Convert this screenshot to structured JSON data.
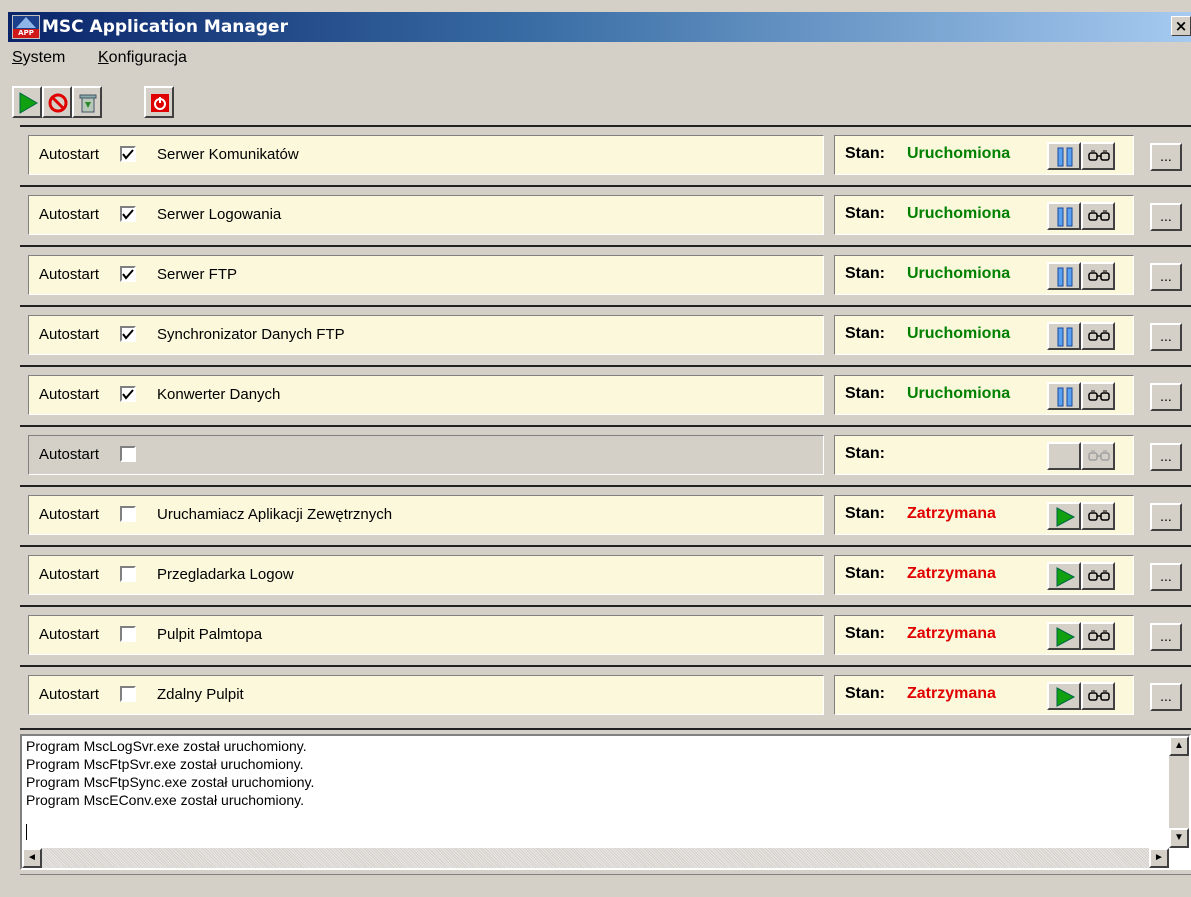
{
  "window": {
    "title": "MSC Application Manager",
    "app_icon_text": "APP",
    "close_label": "×"
  },
  "menu": {
    "system_label": "System",
    "system_accel": "S",
    "system_rest": "ystem",
    "config_label": "Konfiguracja",
    "config_accel": "K",
    "config_rest": "onfiguracja"
  },
  "toolbar": {
    "buttons": [
      {
        "icon": "play-icon"
      },
      {
        "icon": "stop-icon"
      },
      {
        "icon": "recycle-bin-icon"
      },
      {
        "icon": "power-icon"
      }
    ]
  },
  "colors": {
    "running": "#008000",
    "stopped": "#e00000",
    "panel": "#fbf8dc"
  },
  "common": {
    "autostart_label": "Autostart",
    "stan_label": "Stan:",
    "more_label": "..."
  },
  "services": [
    {
      "name": "Serwer Komunikatów",
      "autostart": true,
      "status": "Uruchomiona",
      "state": "running"
    },
    {
      "name": "Serwer Logowania",
      "autostart": true,
      "status": "Uruchomiona",
      "state": "running"
    },
    {
      "name": "Serwer FTP",
      "autostart": true,
      "status": "Uruchomiona",
      "state": "running"
    },
    {
      "name": "Synchronizator Danych FTP",
      "autostart": true,
      "status": "Uruchomiona",
      "state": "running"
    },
    {
      "name": "Konwerter Danych",
      "autostart": true,
      "status": "Uruchomiona",
      "state": "running"
    },
    {
      "name": "",
      "autostart": false,
      "status": "",
      "state": "empty"
    },
    {
      "name": "Uruchamiacz Aplikacji Zewętrznych",
      "autostart": false,
      "status": "Zatrzymana",
      "state": "stopped"
    },
    {
      "name": "Przegladarka Logow",
      "autostart": false,
      "status": "Zatrzymana",
      "state": "stopped"
    },
    {
      "name": "Pulpit Palmtopa",
      "autostart": false,
      "status": "Zatrzymana",
      "state": "stopped"
    },
    {
      "name": "Zdalny Pulpit",
      "autostart": false,
      "status": "Zatrzymana",
      "state": "stopped"
    }
  ],
  "log": {
    "lines": [
      "Program MscLogSvr.exe został uruchomiony.",
      "Program MscFtpSvr.exe został uruchomiony.",
      "Program MscFtpSync.exe został uruchomiony.",
      "Program MscEConv.exe został uruchomiony."
    ]
  }
}
